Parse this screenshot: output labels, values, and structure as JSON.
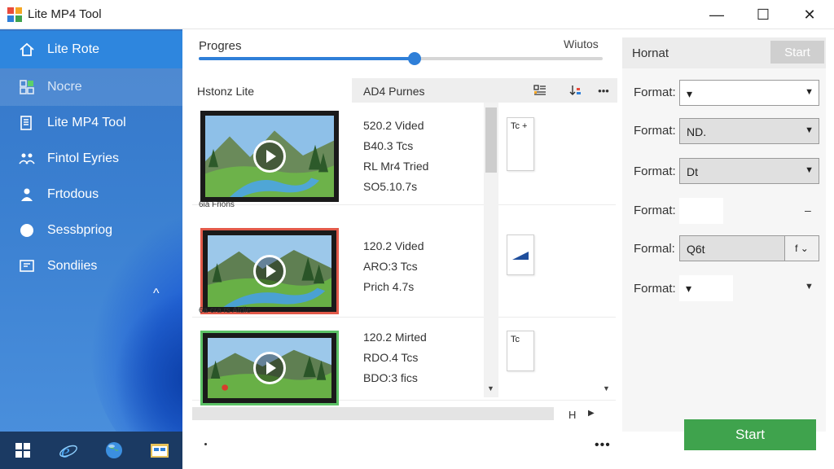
{
  "window": {
    "title": "Lite MP4 Tool",
    "minimize": "—",
    "maximize": "☐",
    "close": "✕"
  },
  "sidebar": {
    "items": [
      {
        "label": "Lite Rote",
        "icon": "home-icon",
        "state": "active"
      },
      {
        "label": "Nocre",
        "icon": "grid-icon",
        "state": "muted"
      },
      {
        "label": "Lite MP4 Tool",
        "icon": "document-icon",
        "state": "normal"
      },
      {
        "label": "Fintol Eyries",
        "icon": "people-icon",
        "state": "normal"
      },
      {
        "label": "Frtodous",
        "icon": "user-icon",
        "state": "normal"
      },
      {
        "label": "Sessbpriog",
        "icon": "circle-icon",
        "state": "normal"
      },
      {
        "label": "Sondiies",
        "icon": "screen-icon",
        "state": "normal"
      }
    ],
    "collapse_chevron": "^"
  },
  "progress": {
    "label": "Progres",
    "window_label": "Wiutos",
    "percent": 0.534
  },
  "list": {
    "left_header": "Hstonz Lite",
    "mid_header": "AD4 Purnes",
    "rows": [
      {
        "caption": "6ia Frions",
        "lines": [
          "520.2 Vided",
          "B40.3 Tcs",
          "RL Mr4 Tried",
          "SO5.10.7s"
        ],
        "doc_text": "Tc +"
      },
      {
        "caption": "6a cra rs Atdie",
        "lines": [
          "120.2 Vided",
          "ARO:3 Tcs",
          "Prich 4.7s"
        ],
        "doc_text": ""
      },
      {
        "caption": "",
        "lines": [
          "120.2 Mirted",
          "RDO.4 Tcs",
          "BDO:3 fics"
        ],
        "doc_text": "Tc"
      }
    ],
    "hscroll_label": "H"
  },
  "right_panel": {
    "title": "Hornat",
    "start_top": "Start",
    "formats": [
      {
        "label": "Format:",
        "value": "▾",
        "style": "white"
      },
      {
        "label": "Format:",
        "value": "ND.",
        "style": "gray"
      },
      {
        "label": "Format:",
        "value": "Dt",
        "style": "gray"
      },
      {
        "label": "Format:",
        "value": "",
        "style": "plain"
      },
      {
        "label": "Formal:",
        "value": "Q6t",
        "style": "split",
        "split": "f ⌄"
      },
      {
        "label": "Format:",
        "value": "▾",
        "style": "plain"
      }
    ],
    "start_button": "Start"
  },
  "colors": {
    "accent": "#2f7fd8",
    "sidebar": "#3a7fd0",
    "start_green": "#3fa34d"
  }
}
